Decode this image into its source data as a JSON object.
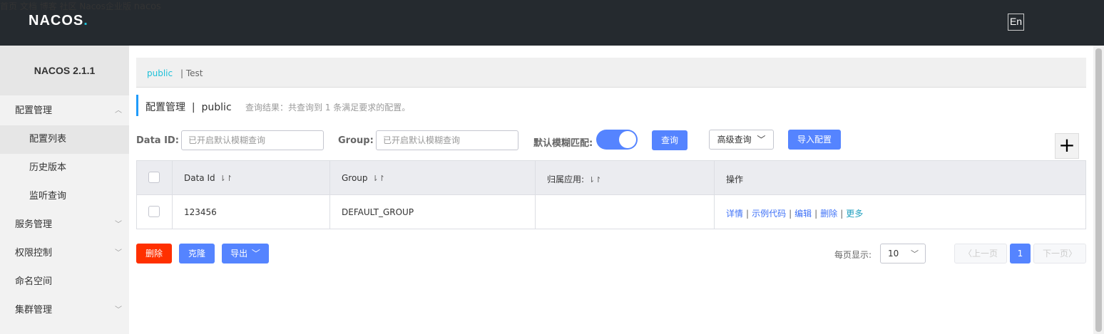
{
  "header": {
    "logo": "NACOS",
    "logo_dot": ".",
    "nav": [
      "首页",
      "文档",
      "博客",
      "社区",
      "Nacos企业版"
    ],
    "lang": "En",
    "user": "nacos"
  },
  "sidebar": {
    "version": "NACOS 2.1.1",
    "items": [
      {
        "label": "配置管理",
        "chevron": "chevron-up-icon"
      },
      {
        "label": "配置列表"
      },
      {
        "label": "历史版本"
      },
      {
        "label": "监听查询"
      },
      {
        "label": "服务管理",
        "chevron": "chevron-down-icon"
      },
      {
        "label": "权限控制",
        "chevron": "chevron-down-icon"
      },
      {
        "label": "命名空间"
      },
      {
        "label": "集群管理",
        "chevron": "chevron-down-icon"
      }
    ]
  },
  "namespace": {
    "current": "public",
    "separator_item": "| Test"
  },
  "page": {
    "title": "配置管理  |  public",
    "result": "查询结果：共查询到 1 条满足要求的配置。"
  },
  "filters": {
    "data_id_label": "Data ID:",
    "data_id_placeholder": "已开启默认模糊查询",
    "group_label": "Group:",
    "group_placeholder": "已开启默认模糊查询",
    "fuzzy_label": "默认模糊匹配:",
    "fuzzy_on": true,
    "query_button": "查询",
    "advanced_button": "高级查询",
    "import_button": "导入配置",
    "add_button": "+"
  },
  "table": {
    "columns": [
      "Data Id",
      "Group",
      "归属应用:",
      "操作"
    ],
    "sort_icon": "⇂↾",
    "rows": [
      {
        "data_id": "123456",
        "group": "DEFAULT_GROUP",
        "app": "",
        "ops": [
          "详情",
          "示例代码",
          "编辑",
          "删除",
          "更多"
        ]
      }
    ]
  },
  "bottom": {
    "delete_button": "删除",
    "clone_button": "克隆",
    "export_button": "导出"
  },
  "pagination": {
    "page_size_label": "每页显示:",
    "page_size": "10",
    "prev": "上一页",
    "current": "1",
    "next": "下一页"
  },
  "colors": {
    "primary": "#5584ff",
    "danger": "#ff3000",
    "header_bg": "#252a2f"
  }
}
